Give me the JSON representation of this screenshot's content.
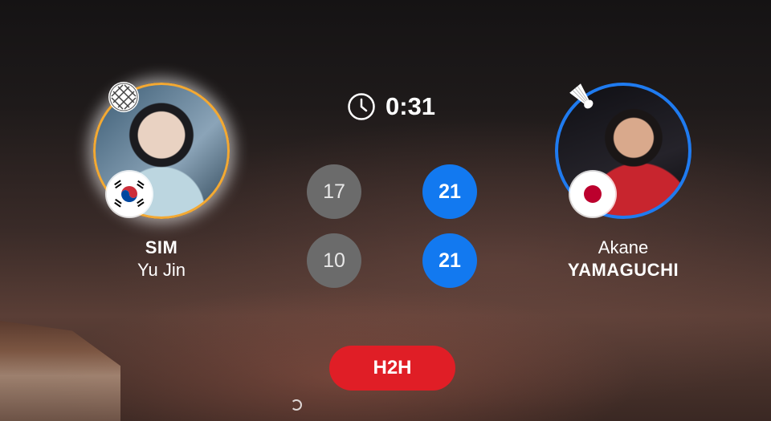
{
  "player_left": {
    "name_line1": "SIM",
    "name_line2": "Yu Jin",
    "flag": "south-korea-flag",
    "indicator_icon": "racket-icon",
    "ring_color": "#f3a933"
  },
  "player_right": {
    "name_line1": "Akane",
    "name_line2": "YAMAGUCHI",
    "flag": "japan-flag",
    "indicator_icon": "shuttlecock-icon",
    "ring_color": "#1f7bf0"
  },
  "match": {
    "duration_icon": "clock-icon",
    "duration": "0:31",
    "games": [
      {
        "left": "17",
        "right": "21"
      },
      {
        "left": "10",
        "right": "21"
      }
    ]
  },
  "actions": {
    "h2h_label": "H2H"
  },
  "colors": {
    "win": "#1279f0",
    "lose": "#6b6b6b",
    "h2h": "#e01e26"
  }
}
